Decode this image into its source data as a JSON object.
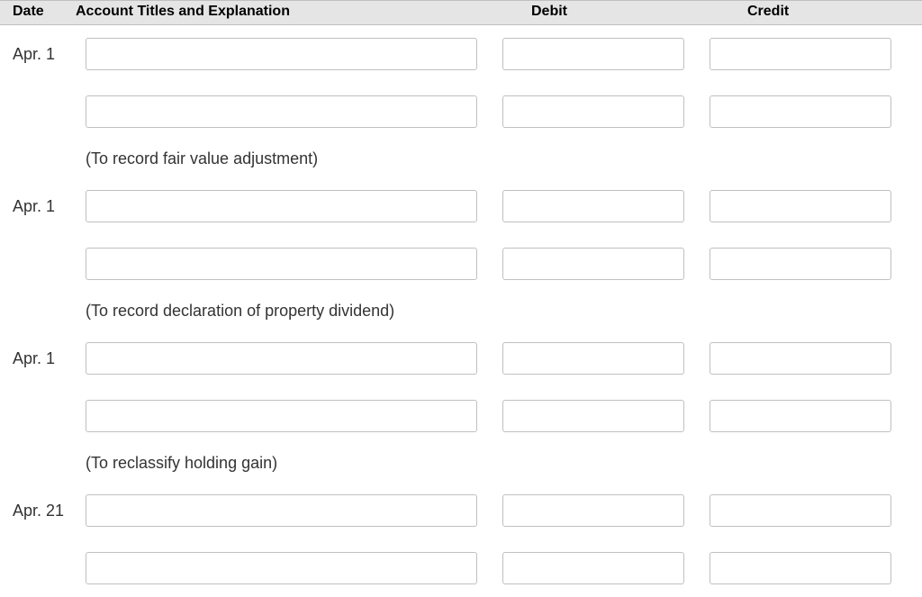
{
  "headers": {
    "date": "Date",
    "account": "Account Titles and Explanation",
    "debit": "Debit",
    "credit": "Credit"
  },
  "entries": [
    {
      "date": "Apr. 1",
      "rows": [
        {
          "account": "",
          "debit": "",
          "credit": ""
        },
        {
          "account": "",
          "debit": "",
          "credit": ""
        }
      ],
      "explanation": "(To record fair value adjustment)"
    },
    {
      "date": "Apr. 1",
      "rows": [
        {
          "account": "",
          "debit": "",
          "credit": ""
        },
        {
          "account": "",
          "debit": "",
          "credit": ""
        }
      ],
      "explanation": "(To record declaration of property dividend)"
    },
    {
      "date": "Apr. 1",
      "rows": [
        {
          "account": "",
          "debit": "",
          "credit": ""
        },
        {
          "account": "",
          "debit": "",
          "credit": ""
        }
      ],
      "explanation": "(To reclassify holding gain)"
    },
    {
      "date": "Apr. 21",
      "rows": [
        {
          "account": "",
          "debit": "",
          "credit": ""
        },
        {
          "account": "",
          "debit": "",
          "credit": ""
        }
      ],
      "explanation": ""
    }
  ]
}
